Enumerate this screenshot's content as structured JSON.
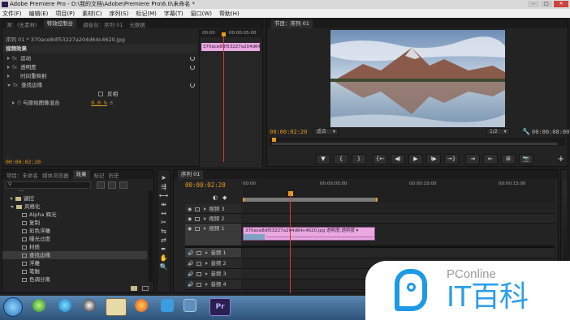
{
  "window": {
    "title": "Adobe Premiere Pro - D:\\我的文档\\Adobe\\Premiere Pro\\6.0\\未命名 *"
  },
  "menu": [
    "文件(F)",
    "编辑(E)",
    "项目(P)",
    "素材(C)",
    "序列(S)",
    "标记(M)",
    "字幕(T)",
    "窗口(W)",
    "帮助(H)"
  ],
  "effect_controls": {
    "tabs": [
      "源：(无素材)",
      "特效控制台",
      "调音台：序列 01",
      "元数据"
    ],
    "header": "序列 01 * 370ace8df53227a204d64c4620.jpg",
    "section": "视频效果",
    "effects": [
      "运动",
      "透明度",
      "时间重映射",
      "查找边缘"
    ],
    "invert_label": "反相",
    "blend_label": "与原始图像混合",
    "blend_value": "0.0 %",
    "clip_label": "370ace8df53227a204d64c4620.jpg",
    "ruler_start": "00:00",
    "ruler_mid": "00:00:05:00",
    "timecode": "00:00:02:20"
  },
  "program_monitor": {
    "tab": "节目：序列 01",
    "timecode": "00:00:02:20",
    "fit": "适合",
    "ratio": "1/2",
    "duration": "00:00:08:00",
    "transport": [
      "▼",
      "{",
      "}",
      "{←",
      "◀I",
      "▶",
      "I▶",
      "→}",
      "⇥",
      "⇤",
      "⊞",
      "⊡",
      "📷"
    ],
    "add": "+"
  },
  "project_panel": {
    "tabs": [
      "项目：未命名",
      "媒体浏览器",
      "效果",
      "标记",
      "历史"
    ],
    "items": [
      {
        "label": "键控",
        "indent": 0,
        "expanded": false
      },
      {
        "label": "风格化",
        "indent": 0,
        "expanded": true
      },
      {
        "label": "Alpha 辉光",
        "indent": 1
      },
      {
        "label": "复制",
        "indent": 1
      },
      {
        "label": "彩色浮雕",
        "indent": 1
      },
      {
        "label": "曝光过度",
        "indent": 1
      },
      {
        "label": "材质",
        "indent": 1
      },
      {
        "label": "查找边缘",
        "indent": 1
      },
      {
        "label": "浮雕",
        "indent": 1
      },
      {
        "label": "笔触",
        "indent": 1
      },
      {
        "label": "色调分离",
        "indent": 1
      }
    ]
  },
  "timeline": {
    "tab": "序列 01",
    "timecode": "00:00:02:20",
    "ruler": [
      "00:00",
      "00:00:05:00",
      "00:00:10:00",
      "00:00:15:00"
    ],
    "tracks": [
      {
        "name": "视频 3",
        "type": "video"
      },
      {
        "name": "视频 2",
        "type": "video"
      },
      {
        "name": "视频 1",
        "type": "video"
      },
      {
        "name": "音频 1",
        "type": "audio"
      },
      {
        "name": "音频 2",
        "type": "audio"
      },
      {
        "name": "音频 3",
        "type": "audio"
      },
      {
        "name": "音频 4",
        "type": "audio"
      }
    ],
    "clip": "370ace8df53227a204d64c4620.jpg  透明度:透明度 ▾"
  },
  "watermark": {
    "brand": "PConline",
    "text": "IT百科"
  },
  "colors": {
    "accent": "#e79b1c",
    "clip": "#e7a9df",
    "playhead": "#d23b3b",
    "background": "#1f1f1f"
  }
}
